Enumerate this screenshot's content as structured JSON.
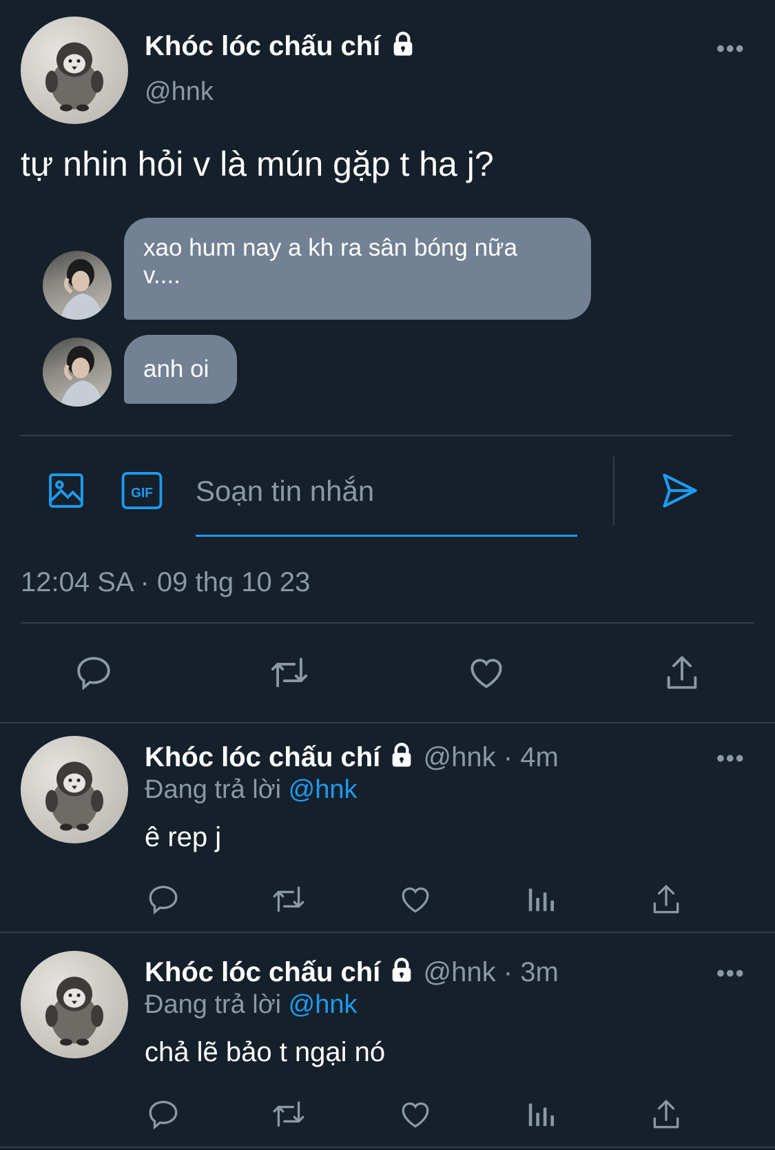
{
  "main_tweet": {
    "display_name": "Khóc lóc chấu chí",
    "handle": "@hnk",
    "text": "tự nhin hỏi v là mún gặp t ha j?",
    "timestamp": "12:04 SA · 09 thg 10 23"
  },
  "dm_embed": {
    "messages": [
      {
        "line1": "xao hum nay a kh ra sân bóng nữa",
        "line2": "v...."
      },
      {
        "line1": "anh oi"
      }
    ],
    "composer_placeholder": "Soạn tin nhắn",
    "icons": [
      "image-icon",
      "gif-icon",
      "send-icon"
    ],
    "gif_label": "GIF"
  },
  "replies": [
    {
      "display_name": "Khóc lóc chấu chí",
      "handle_time": "@hnk · 4m",
      "replying_prefix": "Đang trả lời",
      "replying_to": "@hnk",
      "text": "ê rep j"
    },
    {
      "display_name": "Khóc lóc chấu chí",
      "handle_time": "@hnk · 3m",
      "replying_prefix": "Đang trả lời",
      "replying_to": "@hnk",
      "text": "chả lẽ bảo t ngại nó"
    }
  ],
  "colors": {
    "background": "#15202b",
    "bubble": "#738194",
    "accent": "#1d9bf0",
    "muted": "#8b98a5"
  }
}
